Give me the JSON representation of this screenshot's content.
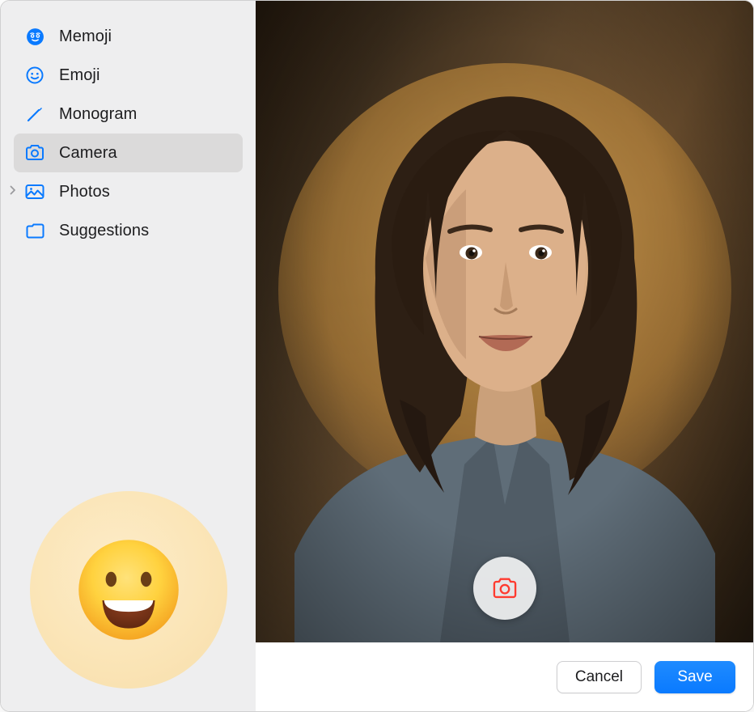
{
  "sidebar": {
    "items": [
      {
        "label": "Memoji",
        "icon": "memoji-icon",
        "selected": false
      },
      {
        "label": "Emoji",
        "icon": "emoji-icon",
        "selected": false
      },
      {
        "label": "Monogram",
        "icon": "monogram-icon",
        "selected": false
      },
      {
        "label": "Camera",
        "icon": "camera-icon",
        "selected": true
      },
      {
        "label": "Photos",
        "icon": "photos-icon",
        "selected": false,
        "expandable": true
      },
      {
        "label": "Suggestions",
        "icon": "suggestions-icon",
        "selected": false
      }
    ],
    "current_picture": {
      "type": "emoji",
      "emoji_name": "grinning-face"
    }
  },
  "main": {
    "capture_button_label": "Take Photo"
  },
  "footer": {
    "cancel_label": "Cancel",
    "save_label": "Save"
  },
  "colors": {
    "accent": "#0a7aff",
    "sidebar_bg": "#eeeeef",
    "selected_bg": "#dbdada"
  }
}
